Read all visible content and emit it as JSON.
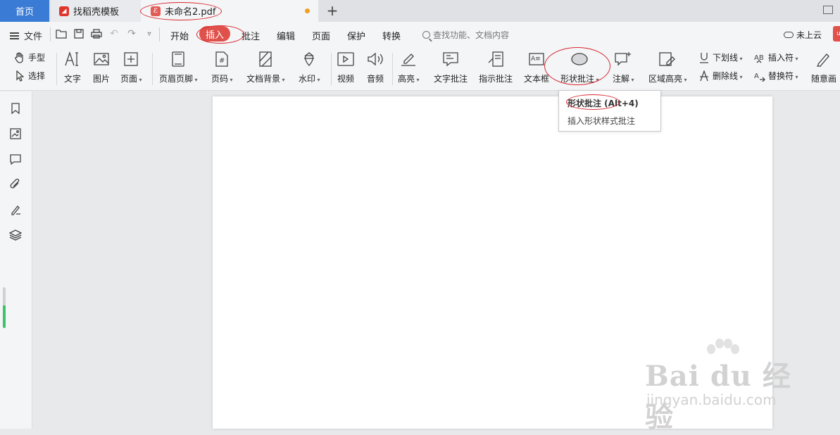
{
  "tabs": {
    "home": "首页",
    "template": "找稻壳模板",
    "document": "未命名2.pdf"
  },
  "menu": {
    "file": "文件",
    "tabs": [
      "开始",
      "插入",
      "批注",
      "编辑",
      "页面",
      "保护",
      "转换"
    ],
    "search_placeholder": "查找功能、文档内容",
    "cloud": "未上云"
  },
  "ribbon": {
    "hand": "手型",
    "select": "选择",
    "text": "文字",
    "image": "图片",
    "page": "页面",
    "header_footer": "页眉页脚",
    "page_number": "页码",
    "background": "文档背景",
    "watermark": "水印",
    "video": "视频",
    "audio": "音频",
    "highlight": "高亮",
    "text_comment": "文字批注",
    "pointer_comment": "指示批注",
    "textbox": "文本框",
    "shape_comment": "形状批注",
    "note": "注解",
    "area_highlight": "区域高亮",
    "underline": "下划线",
    "strikethrough": "删除线",
    "insert_symbol": "插入符",
    "replace_symbol": "替换符",
    "freehand": "随意画"
  },
  "tooltip": {
    "title": "形状批注 (Alt+4)",
    "description": "插入形状样式批注"
  },
  "watermark": {
    "brand": "Bai du 经验",
    "url": "jingyan.baidu.com"
  },
  "colors": {
    "accent_blue": "#3a7bd5",
    "insert_tab_red": "#e0514b",
    "annotation_red": "#d8282e"
  }
}
